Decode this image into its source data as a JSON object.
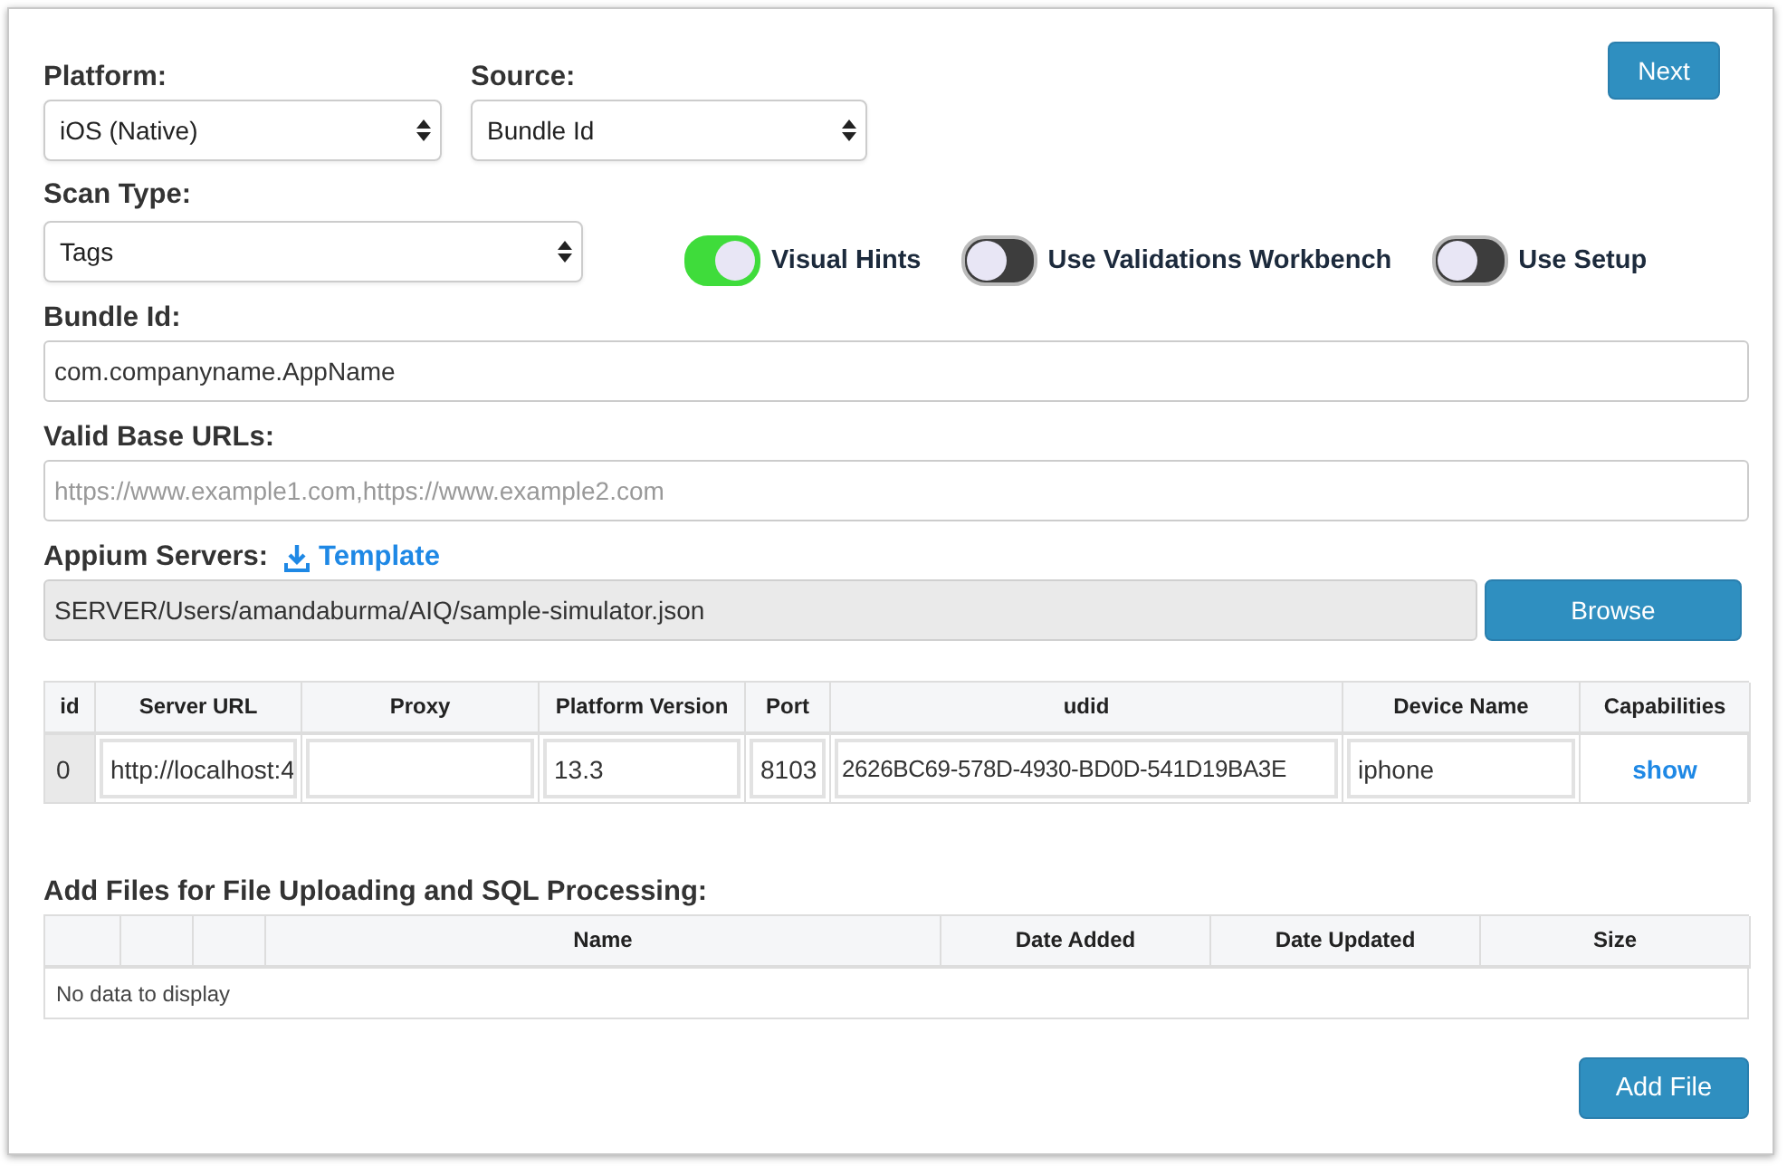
{
  "next_button": "Next",
  "platform": {
    "label": "Platform:",
    "value": "iOS (Native)"
  },
  "source": {
    "label": "Source:",
    "value": "Bundle Id"
  },
  "scan_type": {
    "label": "Scan Type:",
    "value": "Tags"
  },
  "toggles": [
    {
      "label": "Visual Hints",
      "on": true
    },
    {
      "label": "Use Validations Workbench",
      "on": false
    },
    {
      "label": "Use Setup",
      "on": false
    }
  ],
  "bundle_id": {
    "label": "Bundle Id:",
    "value": "com.companyname.AppName"
  },
  "valid_base_urls": {
    "label": "Valid Base URLs:",
    "placeholder": "https://www.example1.com,https://www.example2.com"
  },
  "appium_servers": {
    "label": "Appium Servers:",
    "template_link": "Template",
    "file_path": "SERVER/Users/amandaburma/AIQ/sample-simulator.json",
    "browse_button": "Browse"
  },
  "servers_table": {
    "columns": [
      "id",
      "Server URL",
      "Proxy",
      "Platform Version",
      "Port",
      "udid",
      "Device Name",
      "Capabilities"
    ],
    "rows": [
      {
        "id": "0",
        "server_url": "http://localhost:4",
        "proxy": "",
        "platform_version": "13.3",
        "port": "8103",
        "udid": "2626BC69-578D-4930-BD0D-541D19BA3E",
        "device_name": "iphone",
        "capabilities": "show"
      }
    ]
  },
  "files": {
    "label": "Add Files for File Uploading and SQL Processing:",
    "columns": [
      "Name",
      "Date Added",
      "Date Updated",
      "Size"
    ],
    "empty_text": "No data to display",
    "add_button": "Add File"
  }
}
